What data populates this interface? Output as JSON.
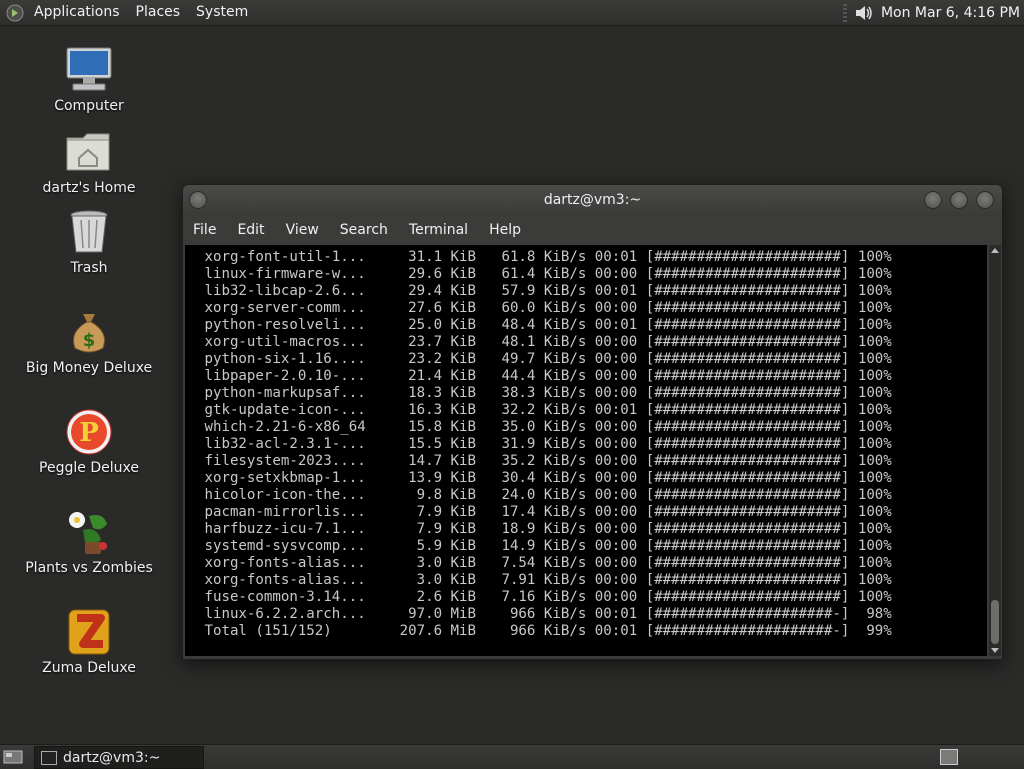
{
  "top_panel": {
    "menus": [
      "Applications",
      "Places",
      "System"
    ],
    "clock": "Mon Mar  6,  4:16 PM"
  },
  "desktop_icons": [
    {
      "label": "Computer",
      "icon": "computer-icon"
    },
    {
      "label": "dartz's Home",
      "icon": "home-folder-icon"
    },
    {
      "label": "Trash",
      "icon": "trash-icon"
    },
    {
      "label": "Big Money Deluxe",
      "icon": "money-bag-icon"
    },
    {
      "label": "Peggle Deluxe",
      "icon": "peggle-icon"
    },
    {
      "label": "Plants vs Zombies",
      "icon": "plants-vs-zombies-icon"
    },
    {
      "label": "Zuma Deluxe",
      "icon": "zuma-icon"
    }
  ],
  "terminal": {
    "title": "dartz@vm3:~",
    "menus": [
      "File",
      "Edit",
      "View",
      "Search",
      "Terminal",
      "Help"
    ],
    "lines": [
      " xorg-font-util-1...     31.1 KiB   61.8 KiB/s 00:01 [######################] 100%",
      " linux-firmware-w...     29.6 KiB   61.4 KiB/s 00:00 [######################] 100%",
      " lib32-libcap-2.6...     29.4 KiB   57.9 KiB/s 00:01 [######################] 100%",
      " xorg-server-comm...     27.6 KiB   60.0 KiB/s 00:00 [######################] 100%",
      " python-resolveli...     25.0 KiB   48.4 KiB/s 00:01 [######################] 100%",
      " xorg-util-macros...     23.7 KiB   48.1 KiB/s 00:00 [######################] 100%",
      " python-six-1.16....     23.2 KiB   49.7 KiB/s 00:00 [######################] 100%",
      " libpaper-2.0.10-...     21.4 KiB   44.4 KiB/s 00:00 [######################] 100%",
      " python-markupsaf...     18.3 KiB   38.3 KiB/s 00:00 [######################] 100%",
      " gtk-update-icon-...     16.3 KiB   32.2 KiB/s 00:01 [######################] 100%",
      " which-2.21-6-x86_64     15.8 KiB   35.0 KiB/s 00:00 [######################] 100%",
      " lib32-acl-2.3.1-...     15.5 KiB   31.9 KiB/s 00:00 [######################] 100%",
      " filesystem-2023....     14.7 KiB   35.2 KiB/s 00:00 [######################] 100%",
      " xorg-setxkbmap-1...     13.9 KiB   30.4 KiB/s 00:00 [######################] 100%",
      " hicolor-icon-the...      9.8 KiB   24.0 KiB/s 00:00 [######################] 100%",
      " pacman-mirrorlis...      7.9 KiB   17.4 KiB/s 00:00 [######################] 100%",
      " harfbuzz-icu-7.1...      7.9 KiB   18.9 KiB/s 00:00 [######################] 100%",
      " systemd-sysvcomp...      5.9 KiB   14.9 KiB/s 00:00 [######################] 100%",
      " xorg-fonts-alias...      3.0 KiB   7.54 KiB/s 00:00 [######################] 100%",
      " xorg-fonts-alias...      3.0 KiB   7.91 KiB/s 00:00 [######################] 100%",
      " fuse-common-3.14...      2.6 KiB   7.16 KiB/s 00:00 [######################] 100%",
      " linux-6.2.2.arch...     97.0 MiB    966 KiB/s 00:01 [#####################-]  98%",
      " Total (151/152)        207.6 MiB    966 KiB/s 00:01 [#####################-]  99%"
    ]
  },
  "bottom_panel": {
    "task_label": "dartz@vm3:~"
  }
}
